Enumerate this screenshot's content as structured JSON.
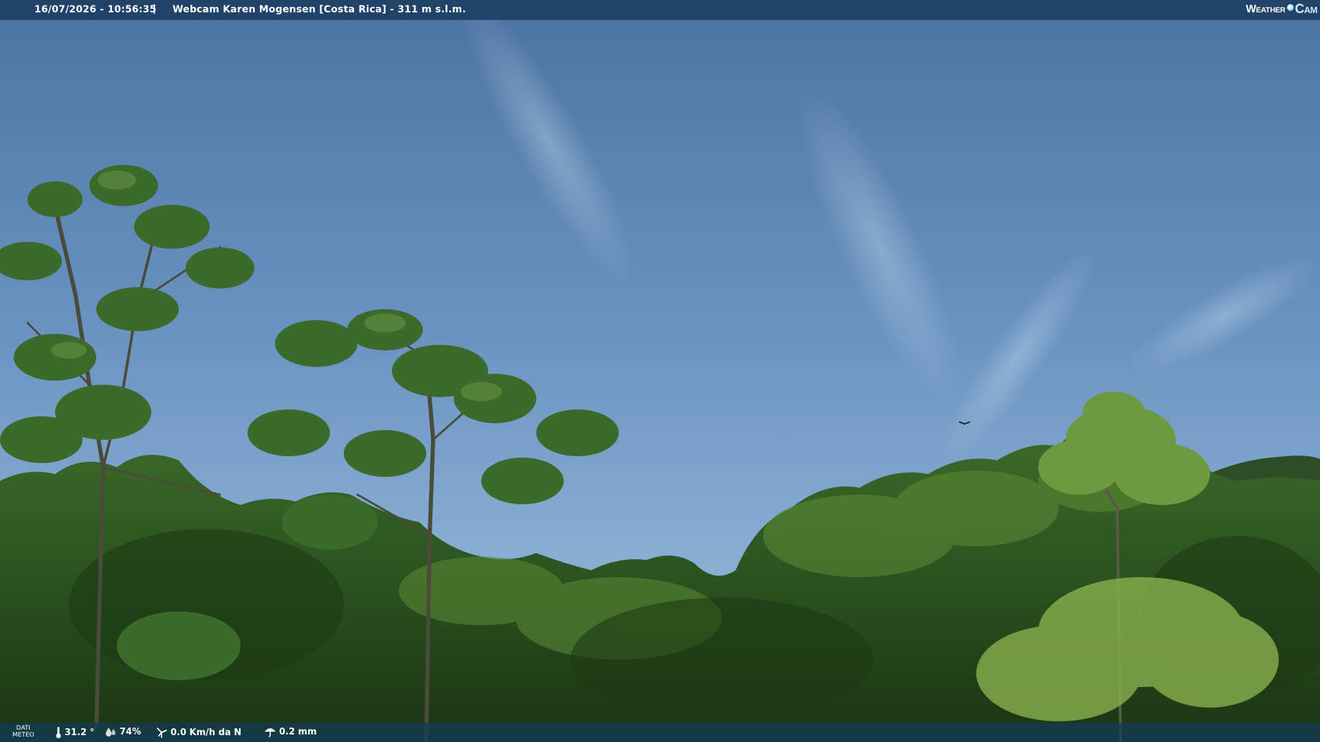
{
  "header": {
    "datetime": "16/07/2026 - 10:56:35",
    "separator": "|",
    "title": "Webcam Karen Mogensen [Costa Rica]  - 311 m s.l.m."
  },
  "brand": {
    "part1": "Weather",
    "part2": "Cam",
    "icon": "globe-icon"
  },
  "meteo": {
    "label_line1": "DATI",
    "label_line2": "METEO",
    "temperature": "31.2 °",
    "humidity": "74%",
    "wind": "0.0 Km/h da N",
    "rain": "0.2 mm",
    "icons": {
      "temperature": "thermometer-icon",
      "humidity": "humidity-icon",
      "wind": "wind-icon",
      "rain": "umbrella-icon"
    }
  },
  "colors": {
    "sky_top": "#4f77a6",
    "sky_bottom": "#8fb5d8",
    "foliage_dark": "#16300f",
    "foliage_mid": "#2f5a1e",
    "foliage_light": "#6c9a3c",
    "bar_bg": "#163458"
  }
}
